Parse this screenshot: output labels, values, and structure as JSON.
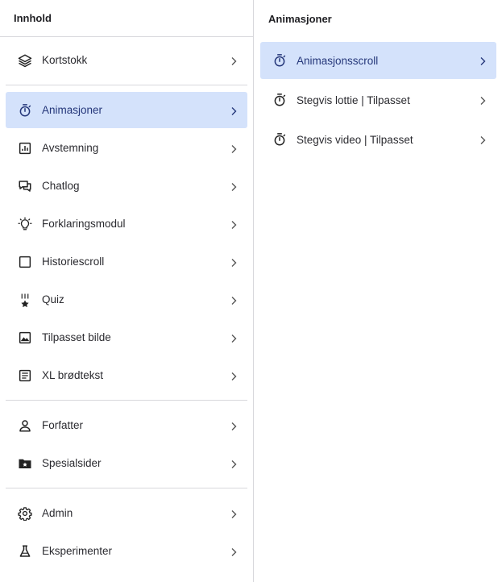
{
  "left_pane": {
    "title": "Innhold",
    "groups": [
      [
        {
          "label": "Kortstokk",
          "icon": "layers-icon"
        }
      ],
      [
        {
          "label": "Animasjoner",
          "icon": "stopwatch-icon",
          "active": true
        },
        {
          "label": "Avstemning",
          "icon": "bar-chart-icon"
        },
        {
          "label": "Chatlog",
          "icon": "chat-icon"
        },
        {
          "label": "Forklaringsmodul",
          "icon": "lightbulb-icon"
        },
        {
          "label": "Historiescroll",
          "icon": "square-icon"
        },
        {
          "label": "Quiz",
          "icon": "medal-icon"
        },
        {
          "label": "Tilpasset bilde",
          "icon": "image-icon"
        },
        {
          "label": "XL brødtekst",
          "icon": "article-icon"
        }
      ],
      [
        {
          "label": "Forfatter",
          "icon": "person-icon"
        },
        {
          "label": "Spesialsider",
          "icon": "star-folder-icon"
        }
      ],
      [
        {
          "label": "Admin",
          "icon": "gear-icon"
        },
        {
          "label": "Eksperimenter",
          "icon": "flask-icon"
        }
      ]
    ]
  },
  "right_pane": {
    "title": "Animasjoner",
    "items": [
      {
        "label": "Animasjonsscroll",
        "icon": "stopwatch-icon",
        "active": true
      },
      {
        "label": "Stegvis lottie | Tilpasset",
        "icon": "stopwatch-icon"
      },
      {
        "label": "Stegvis video | Tilpasset",
        "icon": "stopwatch-icon"
      }
    ]
  },
  "colors": {
    "active_bg": "#d4e2fb",
    "active_text": "#25377a",
    "border": "#d8d8dc"
  }
}
